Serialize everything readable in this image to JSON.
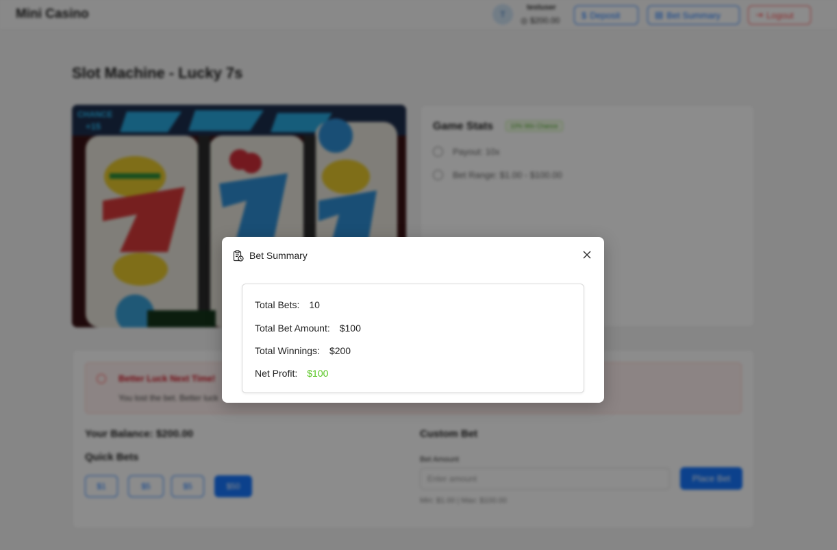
{
  "app": {
    "brand": "Mini Casino"
  },
  "header": {
    "user_initial": "T",
    "username": "testuser",
    "balance": "$200.00",
    "deposit_label": "Deposit",
    "summary_label": "Bet Summary",
    "logout_label": "Logout"
  },
  "game": {
    "title": "Slot Machine - Lucky 7s",
    "stats_title": "Game Stats",
    "stats_tag": "10% Win Chance",
    "payout": "Payout: 10x",
    "bet_range": "Bet Range: $1.00 - $100.00"
  },
  "bet": {
    "alert_title": "Better Luck Next Time!",
    "alert_text": "You lost the bet. Better luck",
    "balance_label": "Your Balance: $200.00",
    "quick_title": "Quick Bets",
    "quick_bets": [
      "$1",
      "$5",
      "$5",
      "$50"
    ],
    "custom_title": "Custom Bet",
    "amount_label": "Bet Amount",
    "amount_placeholder": "Enter amount",
    "place_label": "Place Bet",
    "range_hint": "Min: $1.00 | Max: $100.00"
  },
  "modal": {
    "title": "Bet Summary",
    "total_bets_label": "Total Bets:",
    "total_bets_value": "10",
    "total_amount_label": "Total Bet Amount:",
    "total_amount_value": "$100",
    "total_winnings_label": "Total Winnings:",
    "total_winnings_value": "$200",
    "net_profit_label": "Net Profit:",
    "net_profit_value": "$100",
    "net_profit_color": "#52c41a"
  }
}
